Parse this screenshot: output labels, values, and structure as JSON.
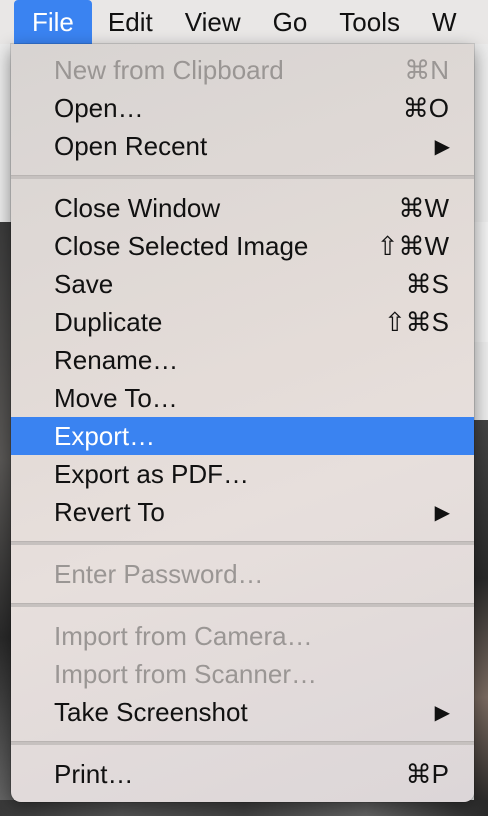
{
  "menubar": {
    "items": [
      "File",
      "Edit",
      "View",
      "Go",
      "Tools",
      "W"
    ],
    "active": "File"
  },
  "menu": {
    "groups": [
      [
        {
          "label": "New from Clipboard",
          "shortcut": "⌘N",
          "disabled": true
        },
        {
          "label": "Open…",
          "shortcut": "⌘O"
        },
        {
          "label": "Open Recent",
          "submenu": true
        }
      ],
      [
        {
          "label": "Close Window",
          "shortcut": "⌘W"
        },
        {
          "label": "Close Selected Image",
          "shortcut": "⇧⌘W"
        },
        {
          "label": "Save",
          "shortcut": "⌘S"
        },
        {
          "label": "Duplicate",
          "shortcut": "⇧⌘S"
        },
        {
          "label": "Rename…"
        },
        {
          "label": "Move To…"
        },
        {
          "label": "Export…",
          "selected": true
        },
        {
          "label": "Export as PDF…"
        },
        {
          "label": "Revert To",
          "submenu": true
        }
      ],
      [
        {
          "label": "Enter Password…",
          "disabled": true
        }
      ],
      [
        {
          "label": "Import from Camera…",
          "disabled": true
        },
        {
          "label": "Import from Scanner…",
          "disabled": true
        },
        {
          "label": "Take Screenshot",
          "submenu": true
        }
      ],
      [
        {
          "label": "Print…",
          "shortcut": "⌘P"
        }
      ]
    ],
    "submenu_arrow": "▶",
    "selection_color": "#3a83f1"
  }
}
